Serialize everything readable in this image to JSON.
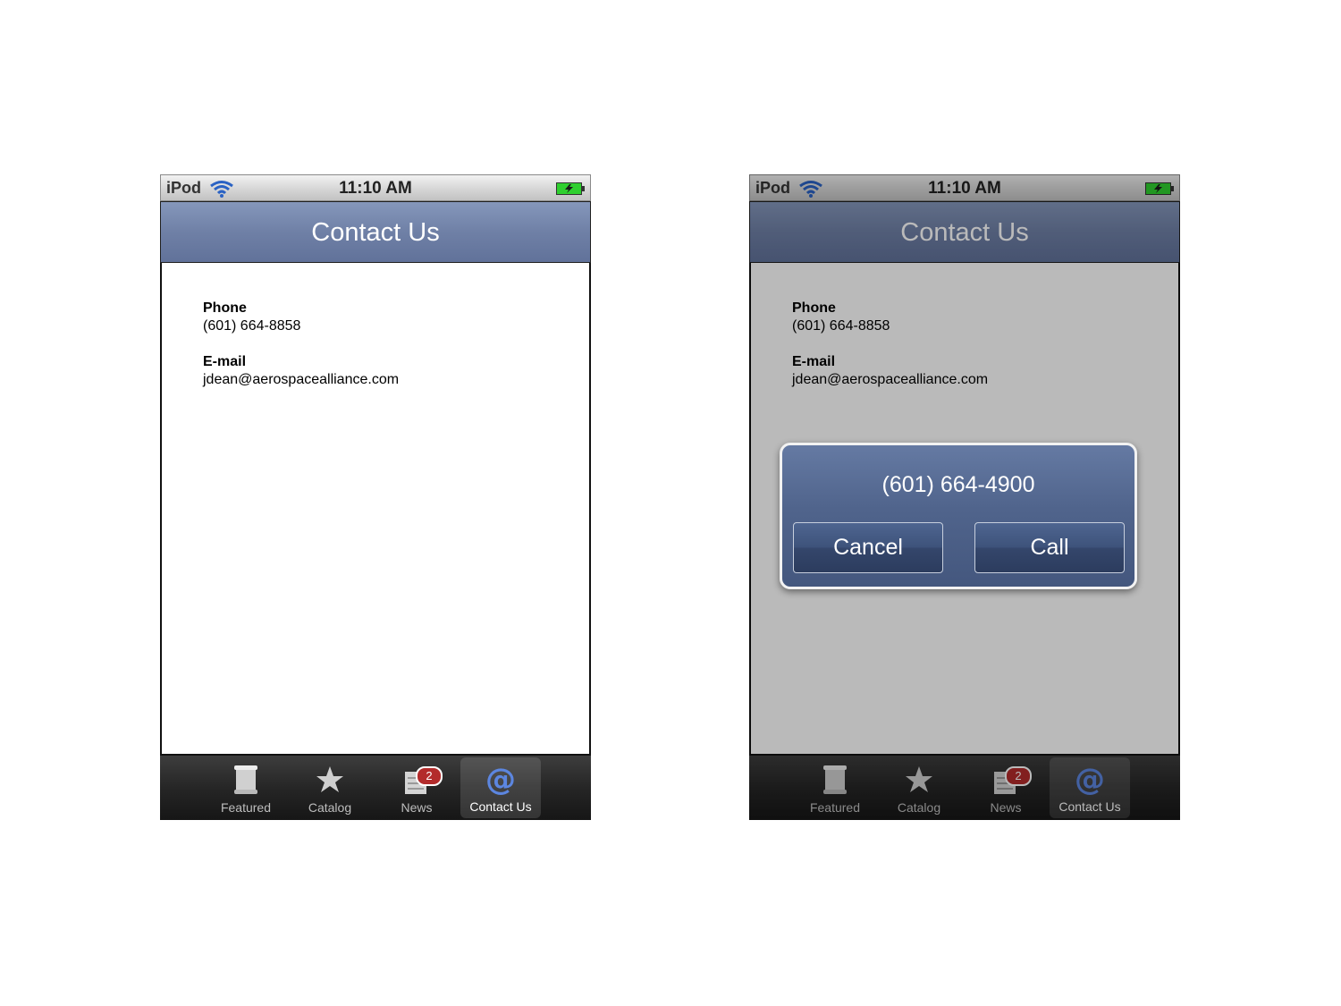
{
  "status_bar": {
    "carrier": "iPod",
    "time": "11:10 AM"
  },
  "nav": {
    "title": "Contact Us"
  },
  "contact": {
    "phone_label": "Phone",
    "phone_value": "(601) 664-8858",
    "email_label": "E-mail",
    "email_value": "jdean@aerospacealliance.com"
  },
  "tabs": [
    {
      "label": "Featured",
      "icon": "scroll-icon"
    },
    {
      "label": "Catalog",
      "icon": "star-icon"
    },
    {
      "label": "News",
      "icon": "newspaper-icon",
      "badge": "2"
    },
    {
      "label": "Contact Us",
      "icon": "at-sign-icon",
      "selected": true
    }
  ],
  "alert": {
    "title": "(601) 664-4900",
    "cancel_label": "Cancel",
    "call_label": "Call"
  },
  "colors": {
    "nav_blue": "#6f80a6",
    "alert_blue": "#50648c",
    "badge_red": "#b32b2b",
    "tab_bar": "#262626",
    "battery_green": "#2fcf2f"
  }
}
